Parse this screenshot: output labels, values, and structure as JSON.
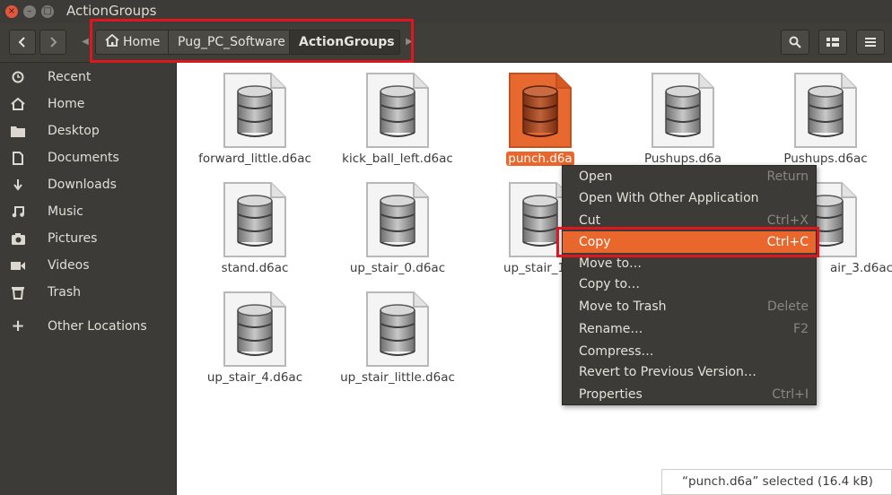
{
  "window": {
    "title": "ActionGroups"
  },
  "titlebar": {
    "close_glyph": "×",
    "min_glyph": "–",
    "max_glyph": "□"
  },
  "header": {
    "back_icon": "chevron-left-icon",
    "forward_icon": "chevron-right-icon",
    "breadcrumb": [
      "Home",
      "Pug_PC_Software",
      "ActionGroups"
    ],
    "search_icon": "search-icon",
    "view_icon": "grid-view-icon",
    "menu_icon": "hamburger-menu-icon"
  },
  "sidebar": {
    "items": [
      {
        "label": "Recent",
        "icon": "clock-icon"
      },
      {
        "label": "Home",
        "icon": "home-icon"
      },
      {
        "label": "Desktop",
        "icon": "folder-icon"
      },
      {
        "label": "Documents",
        "icon": "document-icon"
      },
      {
        "label": "Downloads",
        "icon": "download-icon"
      },
      {
        "label": "Music",
        "icon": "music-icon"
      },
      {
        "label": "Pictures",
        "icon": "camera-icon"
      },
      {
        "label": "Videos",
        "icon": "video-icon"
      },
      {
        "label": "Trash",
        "icon": "trash-icon"
      },
      {
        "label": "Other Locations",
        "icon": "plus-icon"
      }
    ]
  },
  "files": [
    {
      "name": "forward_little.d6ac"
    },
    {
      "name": "kick_ball_left.d6ac"
    },
    {
      "name": "punch.d6a",
      "selected": true
    },
    {
      "name": "Pushups.d6a"
    },
    {
      "name": "Pushups.d6ac"
    },
    {
      "name": "stand.d6ac"
    },
    {
      "name": "up_stair_0.d6ac"
    },
    {
      "name": "up_stair_1.d"
    },
    {
      "name": "air_3.d6ac"
    },
    {
      "name": "up_stair_4.d6ac"
    },
    {
      "name": "up_stair_little.d6ac"
    }
  ],
  "context_menu": {
    "items": [
      {
        "label": "Open",
        "shortcut": "Return"
      },
      {
        "label": "Open With Other Application",
        "shortcut": ""
      },
      {
        "label": "Cut",
        "shortcut": "Ctrl+X"
      },
      {
        "label": "Copy",
        "shortcut": "Ctrl+C",
        "highlighted": true
      },
      {
        "label": "Move to…",
        "shortcut": ""
      },
      {
        "label": "Copy to…",
        "shortcut": ""
      },
      {
        "label": "Move to Trash",
        "shortcut": "Delete"
      },
      {
        "label": "Rename…",
        "shortcut": "F2"
      },
      {
        "label": "Compress…",
        "shortcut": ""
      },
      {
        "label": "Revert to Previous Version…",
        "shortcut": ""
      },
      {
        "label": "Properties",
        "shortcut": "Ctrl+I"
      }
    ]
  },
  "status": {
    "text": "“punch.d6a”  selected  (16.4 kB)"
  },
  "colors": {
    "accent": "#e9662c",
    "annotation": "#e0161e",
    "sidebar_bg": "#3c3b37"
  }
}
